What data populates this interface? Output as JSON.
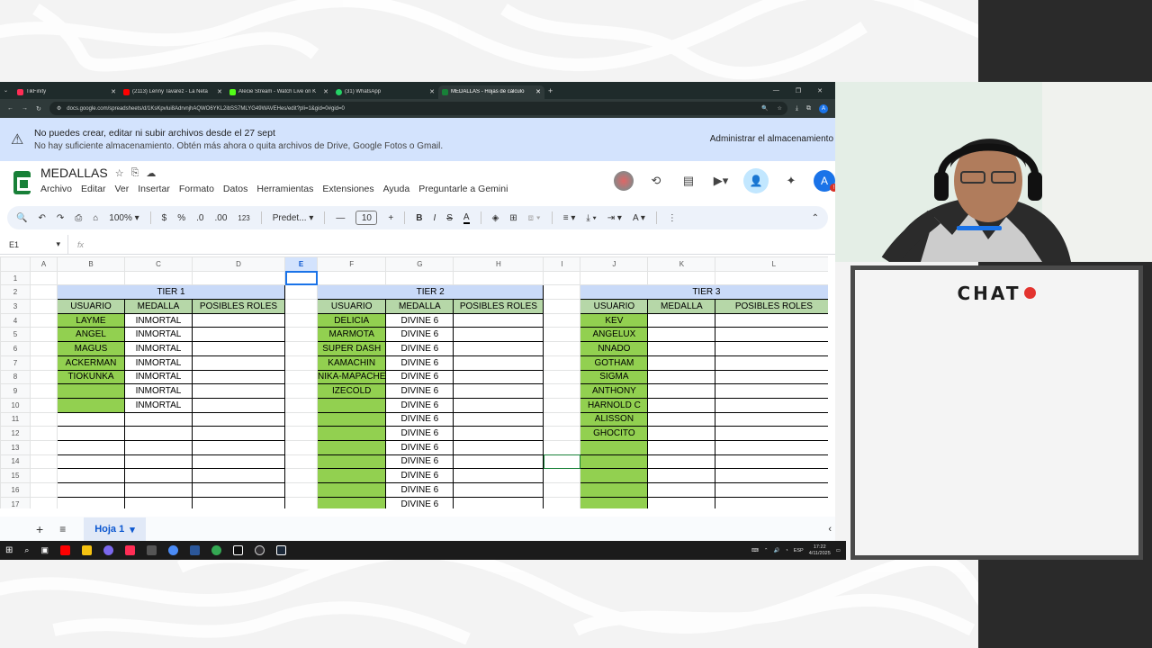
{
  "tabs": [
    {
      "label": "TikFinity",
      "color": "#ff2d55",
      "active": false
    },
    {
      "label": "(2113) Lenny Tavarez - La Neta",
      "color": "#ff0000",
      "active": false
    },
    {
      "label": "Alecie Stream - Watch Live on K",
      "color": "#53fc18",
      "active": false
    },
    {
      "label": "(31) WhatsApp",
      "color": "#25d366",
      "active": false
    },
    {
      "label": "MEDALLAS - Hojas de cálculo",
      "color": "#188038",
      "active": true
    }
  ],
  "url": "docs.google.com/spreadsheets/d/1KsKpvlui8AdrvnjhAQWO6YKL2ibSS7MLYG49WAVEHes/edit?pli=1&gid=0#gid=0",
  "account_initial": "A",
  "banner": {
    "line1": "No puedes crear, editar ni subir archivos desde el 27 sept",
    "line2": "No hay suficiente almacenamiento. Obtén más ahora o quita archivos de Drive, Google Fotos o Gmail.",
    "action": "Administrar el almacenamiento"
  },
  "doc": {
    "title": "MEDALLAS",
    "menus": [
      "Archivo",
      "Editar",
      "Ver",
      "Insertar",
      "Formato",
      "Datos",
      "Herramientas",
      "Extensiones",
      "Ayuda",
      "Preguntarle a Gemini"
    ]
  },
  "toolbar": {
    "zoom": "100%",
    "currency": "$",
    "percent": "%",
    "dec_dec": ".0",
    "dec_inc": ".00",
    "num_fmt": "123",
    "font": "Predet...",
    "font_size": "10"
  },
  "formula": {
    "namebox": "E1",
    "fx": "fx"
  },
  "columns": [
    "A",
    "B",
    "C",
    "D",
    "E",
    "F",
    "G",
    "H",
    "I",
    "J",
    "K",
    "L"
  ],
  "tier1": {
    "title": "TIER 1",
    "headers": [
      "USUARIO",
      "MEDALLA",
      "POSIBLES ROLES"
    ],
    "rows": [
      [
        "LAYME",
        "INMORTAL",
        ""
      ],
      [
        "ANGEL",
        "INMORTAL",
        ""
      ],
      [
        "MAGUS",
        "INMORTAL",
        ""
      ],
      [
        "ACKERMAN",
        "INMORTAL",
        ""
      ],
      [
        "TIOKUNKA",
        "INMORTAL",
        ""
      ],
      [
        "",
        "INMORTAL",
        ""
      ],
      [
        "",
        "INMORTAL",
        ""
      ]
    ]
  },
  "tier2": {
    "title": "TIER 2",
    "headers": [
      "USUARIO",
      "MEDALLA",
      "POSIBLES ROLES"
    ],
    "rows": [
      [
        "DELICIA",
        "DIVINE 6",
        ""
      ],
      [
        "MARMOTA",
        "DIVINE 6",
        ""
      ],
      [
        "SUPER DASH",
        "DIVINE 6",
        ""
      ],
      [
        "KAMACHIN",
        "DIVINE 6",
        ""
      ],
      [
        "NIKA-MAPACHE",
        "DIVINE 6",
        ""
      ],
      [
        "IZECOLD",
        "DIVINE 6",
        ""
      ],
      [
        "",
        "DIVINE 6",
        ""
      ],
      [
        "",
        "DIVINE 6",
        ""
      ],
      [
        "",
        "DIVINE 6",
        ""
      ],
      [
        "",
        "DIVINE 6",
        ""
      ],
      [
        "",
        "DIVINE 6",
        ""
      ],
      [
        "",
        "DIVINE 6",
        ""
      ],
      [
        "",
        "DIVINE 6",
        ""
      ],
      [
        "",
        "DIVINE 6",
        ""
      ]
    ]
  },
  "tier3": {
    "title": "TIER 3",
    "headers": [
      "USUARIO",
      "MEDALLA",
      "POSIBLES ROLES"
    ],
    "rows": [
      [
        "KEV",
        "",
        ""
      ],
      [
        "ANGELUX",
        "",
        ""
      ],
      [
        "NNADO",
        "",
        ""
      ],
      [
        "GOTHAM",
        "",
        ""
      ],
      [
        "SIGMA",
        "",
        ""
      ],
      [
        "ANTHONY",
        "",
        ""
      ],
      [
        "HARNOLD C",
        "",
        ""
      ],
      [
        "ALISSON",
        "",
        ""
      ],
      [
        "GHOCITO",
        "",
        ""
      ]
    ]
  },
  "sheet_tab": "Hoja 1",
  "clock": {
    "time": "17:22",
    "date": "4/11/2025",
    "lang": "ESP"
  },
  "chat": {
    "title": "CHAT"
  }
}
